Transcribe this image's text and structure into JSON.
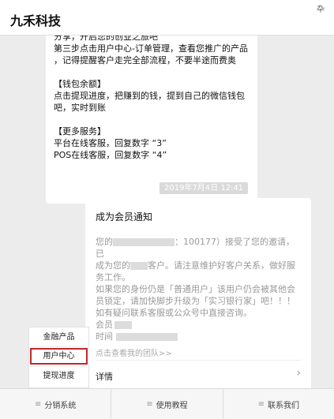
{
  "header": {
    "title": "九禾科技",
    "pin_glyph": "卆"
  },
  "message": {
    "lines": [
      "分享，开启您的创业之旅吧",
      "第三步点击用户中心-订单管理，查看您推广的产品",
      "，记得提醒客户走完全部流程，不要半途而费奥",
      "",
      "【钱包余额】",
      "点击提现进度，把赚到的钱，提到自己的微信钱包",
      "吧，实时到账",
      "",
      "【更多服务】",
      "平台在线客服，回复数字 “3”",
      "POS在线客服，回复数字 “4”"
    ]
  },
  "timestamp": "2019年7月4日 12:41",
  "card": {
    "title": "成为会员通知",
    "body_1a": "您的",
    "body_1b": "：100177）接受了您的邀请，已",
    "body_2a": "成为您的",
    "body_2b": "客户。请注意维护好客户关系，做好服",
    "body_3": "务工作。",
    "body_4": "如果您的身份仍是「普通用户」该用户仍会被其他会",
    "body_5": "员锁定，请加快脚步升级为「实习银行家」吧！！！",
    "body_6": "如有疑问联系客服或公众号中直接咨询。",
    "body_7": "会员",
    "body_8": "时间",
    "team_link": "点击查看我的团队>>",
    "detail_label": "详情",
    "detail_arrow": "›"
  },
  "popup_menu": {
    "items": [
      "金融产品",
      "用户中心",
      "提现进度"
    ]
  },
  "bottom_bar": {
    "tabs": [
      "分销系统",
      "使用教程",
      "联系我们"
    ],
    "menu_glyph": "≡"
  }
}
